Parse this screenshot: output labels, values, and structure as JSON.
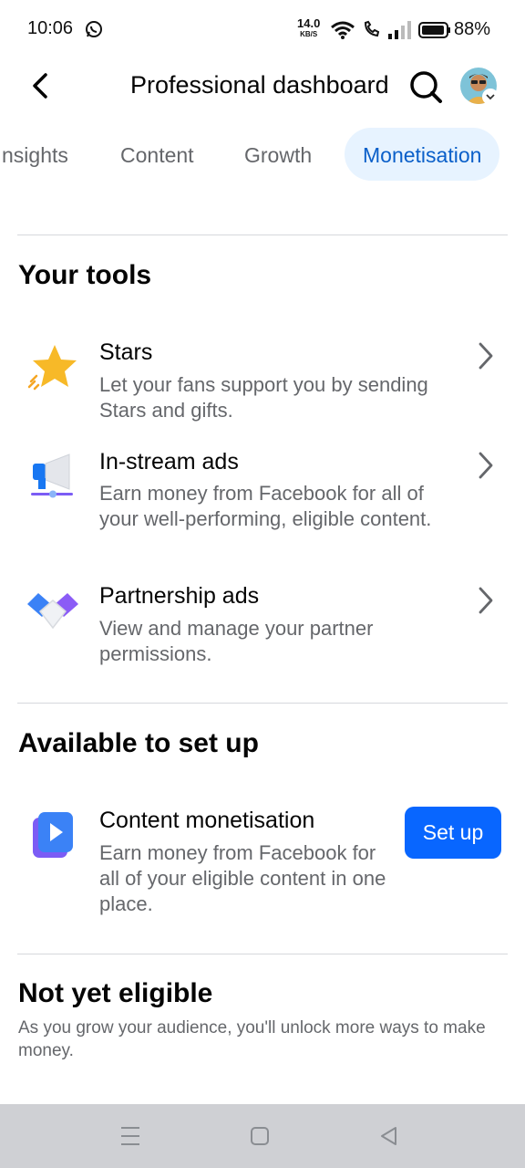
{
  "status_bar": {
    "time": "10:06",
    "net_speed": "14.0",
    "net_unit": "KB/S",
    "battery": "88%"
  },
  "header": {
    "title": "Professional dashboard"
  },
  "tabs": [
    {
      "label": "nsights"
    },
    {
      "label": "Content"
    },
    {
      "label": "Growth"
    },
    {
      "label": "Monetisation",
      "active": true
    }
  ],
  "your_tools": {
    "title": "Your tools",
    "items": [
      {
        "title": "Stars",
        "desc": "Let your fans support you by sending Stars and gifts.",
        "icon": "star-icon"
      },
      {
        "title": "In-stream ads",
        "desc": "Earn money from Facebook for all of your well-performing, eligible content.",
        "icon": "megaphone-icon"
      },
      {
        "title": "Partnership ads",
        "desc": "View and manage your partner permissions.",
        "icon": "handshake-icon"
      }
    ]
  },
  "available": {
    "title": "Available to set up",
    "item": {
      "title": "Content monetisation",
      "desc": "Earn money from Facebook for all of your eligible content in one place.",
      "button": "Set up",
      "icon": "play-icon"
    }
  },
  "not_eligible": {
    "title": "Not yet eligible",
    "desc": "As you grow your audience, you'll unlock more ways to make money."
  },
  "colors": {
    "accent": "#0866ff",
    "active_tab_bg": "#e7f3ff",
    "active_tab_text": "#0a5fc9",
    "secondary_text": "#65676b"
  }
}
